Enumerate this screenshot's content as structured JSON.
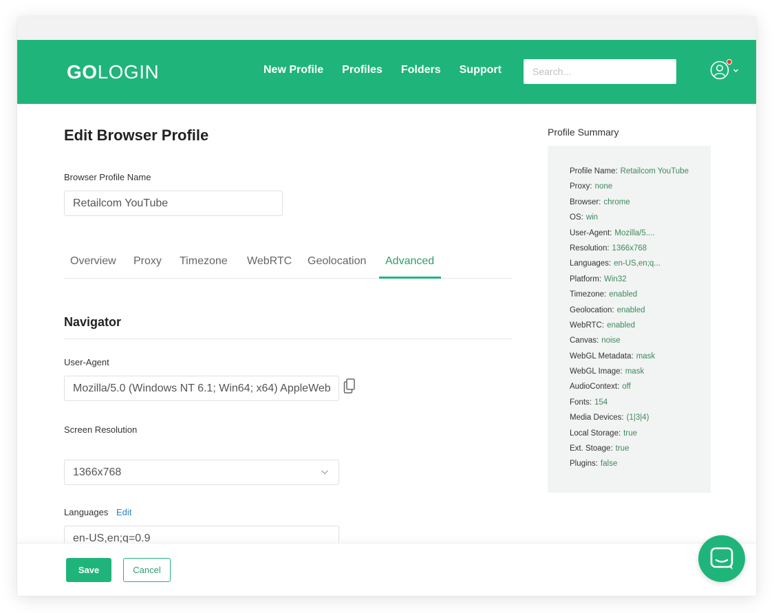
{
  "colors": {
    "brand": "#1fb57a",
    "brand_text": "#2b9e6d",
    "summary_value": "#3c8a5c",
    "link": "#2a83c1",
    "traffic_red": "#ff5f57",
    "traffic_yellow": "#febc2e",
    "traffic_green": "#28c840",
    "notification": "#e53935"
  },
  "header": {
    "logo": {
      "go": "GO",
      "login": "LOGIN"
    },
    "nav": [
      "New Profile",
      "Profiles",
      "Folders",
      "Support"
    ],
    "search_placeholder": "Search...",
    "icons": {
      "user": "user-circle-icon",
      "caret": "chevron-down-icon"
    }
  },
  "page": {
    "title": "Edit Browser Profile",
    "profile_name_label": "Browser Profile Name",
    "profile_name_value": "Retailcom YouTube",
    "tabs": [
      "Overview",
      "Proxy",
      "Timezone",
      "WebRTC",
      "Geolocation",
      "Advanced"
    ],
    "active_tab": "Advanced",
    "section_title": "Navigator",
    "user_agent_label": "User-Agent",
    "user_agent_value": "Mozilla/5.0 (Windows NT 6.1; Win64; x64) AppleWeb",
    "copy_icon": "copy-icon",
    "resolution_label": "Screen Resolution",
    "resolution_value": "1366x768",
    "languages_label": "Languages",
    "languages_edit": "Edit",
    "languages_value": "en-US,en;q=0.9"
  },
  "summary": {
    "title": "Profile Summary",
    "rows": [
      {
        "key": "Profile Name:",
        "value": "Retailcom YouTube"
      },
      {
        "key": "Proxy:",
        "value": "none"
      },
      {
        "key": "Browser:",
        "value": "chrome"
      },
      {
        "key": "OS:",
        "value": "win"
      },
      {
        "key": "User-Agent:",
        "value": "Mozilla/5...."
      },
      {
        "key": "Resolution:",
        "value": "1366x768"
      },
      {
        "key": "Languages:",
        "value": "en-US,en;q..."
      },
      {
        "key": "Platform:",
        "value": "Win32"
      },
      {
        "key": "Timezone:",
        "value": "enabled"
      },
      {
        "key": "Geolocation:",
        "value": "enabled"
      },
      {
        "key": "WebRTC:",
        "value": "enabled"
      },
      {
        "key": "Canvas:",
        "value": "noise"
      },
      {
        "key": "WebGL Metadata:",
        "value": "mask"
      },
      {
        "key": "WebGL Image:",
        "value": "mask"
      },
      {
        "key": "AudioContext:",
        "value": "off"
      },
      {
        "key": "Fonts:",
        "value": "154"
      },
      {
        "key": "Media Devices:",
        "value": "(1|3|4)"
      },
      {
        "key": "Local Storage:",
        "value": "true"
      },
      {
        "key": "Ext. Stoage:",
        "value": "true"
      },
      {
        "key": "Plugins:",
        "value": "false"
      }
    ]
  },
  "footer": {
    "save": "Save",
    "cancel": "Cancel",
    "chat_icon": "chat-bubble-icon"
  }
}
